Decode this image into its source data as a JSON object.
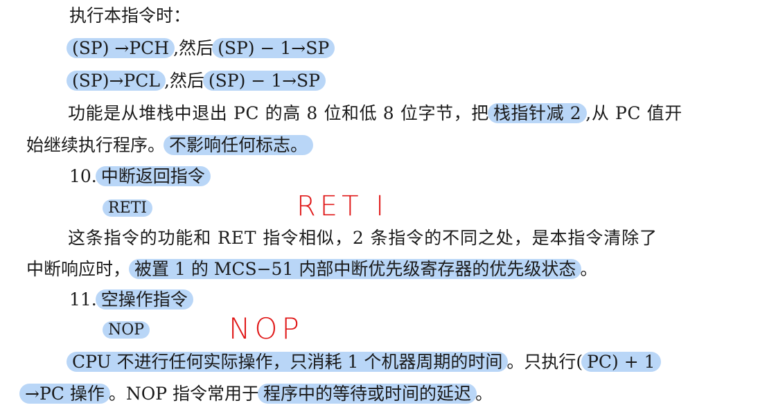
{
  "document": {
    "line1": "执行本指令时：",
    "line2": {
      "h1": "(SP) →PCH",
      "t1": ",然后",
      "h2": "(SP) − 1→SP"
    },
    "line3": {
      "h1": "(SP)→PCL",
      "t1": ",然后",
      "h2": "(SP) − 1→SP"
    },
    "line4": {
      "t1": "功能是从堆栈中退出 PC 的高 8 位和低 8 位字节，把",
      "h1": "栈指针减 2",
      "t2": ",从 PC 值开"
    },
    "line5": {
      "t1": "始继续执行程序。",
      "h1": "不影响任何标志。"
    },
    "line6": {
      "num": "10.",
      "h1": "中断返回指令"
    },
    "line7": {
      "h1": "RETI"
    },
    "line8": "这条指令的功能和 RET 指令相似，2 条指令的不同之处，是本指令清除了",
    "line9": {
      "t1": "中断响应时，",
      "h1": "被置 1 的 MCS−51 内部中断优先级寄存器的优先级状态",
      "t2": "。"
    },
    "line10": {
      "num": "11.",
      "h1": "空操作指令"
    },
    "line11": {
      "h1": "NOP"
    },
    "line12": {
      "h1": "CPU 不进行任何实际操作，只消耗 1 个机器周期的时间",
      "t1": "。只执行(",
      "h2": "PC) + 1"
    },
    "line13": {
      "h1": "→PC 操作",
      "t1": "。NOP 指令常用于",
      "h2": "程序中的等待或时间的延迟",
      "t2": "。"
    }
  },
  "annotations": {
    "reti_note": "RET I",
    "nop_note": "NOP"
  },
  "colors": {
    "highlight": "#b9d6f7",
    "annotation_ink": "#e01818",
    "text": "#1a1a1a"
  }
}
